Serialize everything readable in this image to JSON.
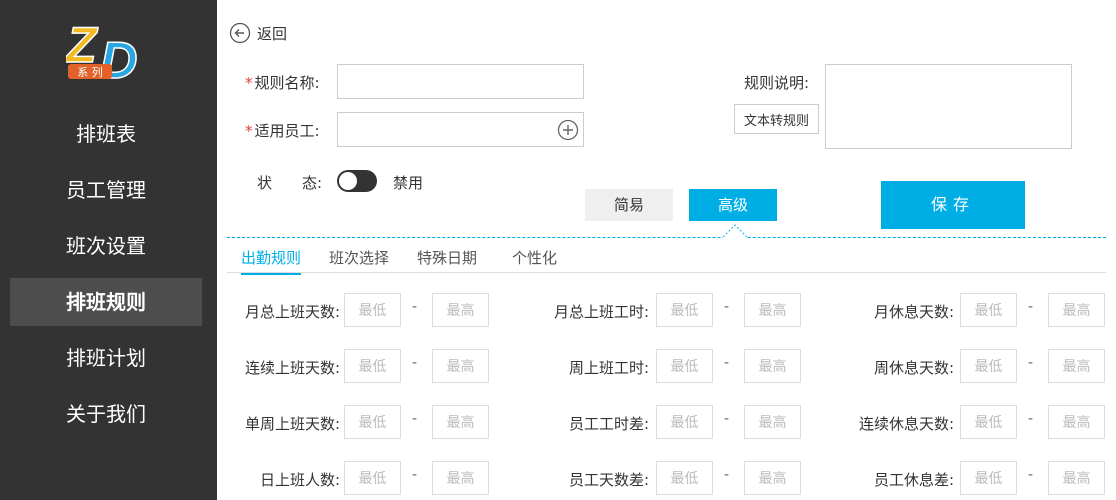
{
  "logo": {
    "letters": "ZD",
    "tag": "系列",
    "colors": {
      "z": "#f5b921",
      "d": "#2aa6e0",
      "tag_bg": "#e2622a"
    }
  },
  "sidebar": {
    "items": [
      {
        "label": "排班表",
        "active": false
      },
      {
        "label": "员工管理",
        "active": false
      },
      {
        "label": "班次设置",
        "active": false
      },
      {
        "label": "排班规则",
        "active": true
      },
      {
        "label": "排班计划",
        "active": false
      },
      {
        "label": "关于我们",
        "active": false
      }
    ]
  },
  "header": {
    "back_label": "返回"
  },
  "form": {
    "required_mark": "*",
    "rule_name_label": "规则名称:",
    "rule_name_value": "",
    "applicable_label": "适用员工:",
    "applicable_value": "",
    "status_label": "状　　态:",
    "status_text": "禁用",
    "rule_desc_label": "规则说明:",
    "rule_desc_value": "",
    "text_to_rule_button": "文本转规则"
  },
  "mode": {
    "easy": "简易",
    "advanced": "高级",
    "active": "advanced"
  },
  "save_label": "保存",
  "tabs": [
    "出勤规则",
    "班次选择",
    "特殊日期",
    "个性化"
  ],
  "range": {
    "min_placeholder": "最低",
    "max_placeholder": "最高",
    "separator": "-"
  },
  "rules": {
    "col1": [
      "月总上班天数:",
      "连续上班天数:",
      "单周上班天数:",
      "日上班人数:"
    ],
    "col2": [
      "月总上班工时:",
      "周上班工时:",
      "员工工时差:",
      "员工天数差:"
    ],
    "col3": [
      "月休息天数:",
      "周休息天数:",
      "连续休息天数:",
      "员工休息差:"
    ]
  },
  "colors": {
    "sidebar_bg": "#333333",
    "sidebar_active": "#4d4d4d",
    "accent": "#00aee6"
  }
}
